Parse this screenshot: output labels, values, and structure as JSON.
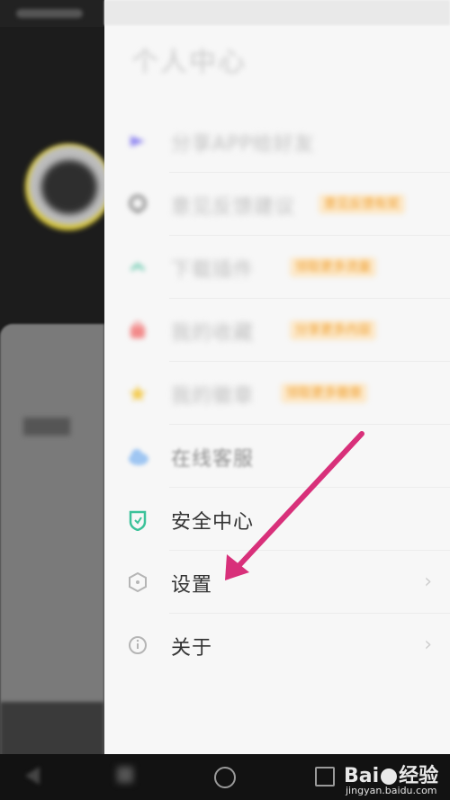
{
  "drawer": {
    "title": "个人中心",
    "items": [
      {
        "label": "分享APP给好友",
        "tag": ""
      },
      {
        "label": "意见反馈建议",
        "tag": "意见反馈有奖"
      },
      {
        "label": "下载插件",
        "tag": "领取更多流量"
      },
      {
        "label": "我的收藏",
        "tag": "分享更多内容"
      },
      {
        "label": "我的徽章",
        "tag": "领取更多徽章"
      },
      {
        "label": "在线客服",
        "tag": ""
      },
      {
        "label": "安全中心",
        "tag": ""
      },
      {
        "label": "设置",
        "tag": ""
      },
      {
        "label": "关于",
        "tag": ""
      }
    ]
  },
  "watermark": {
    "brand": "Bai",
    "brand_suffix": "经验",
    "url": "jingyan.baidu.com"
  },
  "colors": {
    "arrow": "#d8307a",
    "tag_text": "#f0a030",
    "shield": "#3cc29a"
  }
}
